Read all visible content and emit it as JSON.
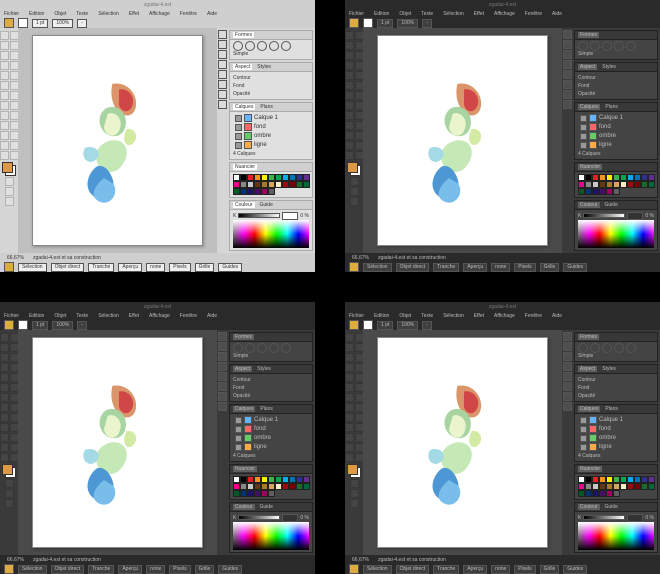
{
  "document_title": "zgadai-4.est",
  "menu": [
    "Fichier",
    "Edition",
    "Objet",
    "Texte",
    "Sélection",
    "Effet",
    "Affichage",
    "Fenêtre",
    "Aide"
  ],
  "controlbar": {
    "fill": "#ddaa44",
    "stroke": "none",
    "stroke_weight": "1 pt",
    "opacity": "100%",
    "style": "-"
  },
  "status": {
    "zoom": "66,67%",
    "info": "zgadai-4.est et sa construction"
  },
  "bottom": [
    "Sélection",
    "Objet direct",
    "Tranche",
    "Aperçu",
    "none",
    "Pixels",
    "Grille",
    "Guides"
  ],
  "tools": {
    "rows": 16,
    "names": [
      "selection",
      "direct-select",
      "magic-wand",
      "lasso",
      "pen",
      "type",
      "line",
      "rectangle",
      "brush",
      "pencil",
      "blob",
      "eraser",
      "rotate",
      "scale",
      "warp",
      "free-transform",
      "symbol-spray",
      "graph",
      "mesh",
      "gradient",
      "eyedropper",
      "blend",
      "artboard",
      "slice",
      "hand",
      "zoom",
      "fill-stroke",
      "color-mode",
      "screen-mode",
      "draw-mode"
    ]
  },
  "panels": {
    "appearance": {
      "tabs": [
        "Aspect",
        "Styles"
      ],
      "items": [
        "Contour",
        "Fond",
        "Opacité"
      ]
    },
    "brushes": {
      "tabs": [
        "Formes"
      ],
      "row_label": "Simple"
    },
    "layers": {
      "tabs": [
        "Calques",
        "Plans"
      ],
      "items": [
        {
          "name": "Calque 1",
          "color": "#64b4ff"
        },
        {
          "name": "fond",
          "color": "#ff6666"
        },
        {
          "name": "ombre",
          "color": "#66cc66"
        },
        {
          "name": "ligne",
          "color": "#ffaa44"
        }
      ],
      "footer": "4 Calques"
    },
    "swatches": {
      "tabs": [
        "Nuancier"
      ],
      "colors": [
        "#ffffff",
        "#000000",
        "#ed1c24",
        "#f7941d",
        "#fff200",
        "#39b54a",
        "#00a651",
        "#00aeef",
        "#0072bc",
        "#2e3192",
        "#662d91",
        "#ec008c",
        "#898989",
        "#c8c8c8",
        "#603913",
        "#a6792c",
        "#d7a45c",
        "#fdecc6",
        "#9e0b0f",
        "#790000",
        "#1a6b2a",
        "#006838",
        "#005826",
        "#003471",
        "#1b1464",
        "#440e62",
        "#9e005d",
        "#5e5e5e"
      ]
    },
    "color": {
      "tabs": [
        "Couleur",
        "Guide"
      ],
      "model": "K",
      "value": "0 %"
    }
  },
  "themes": {
    "a": "light",
    "b": "dark",
    "c": "dark",
    "d": "dark"
  }
}
